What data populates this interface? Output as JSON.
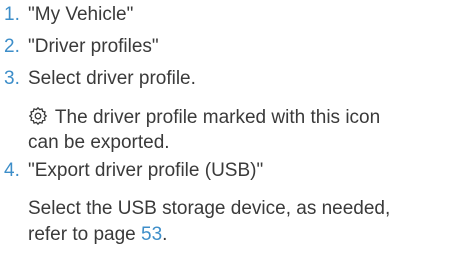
{
  "steps": [
    {
      "number": "1.",
      "text": "\"My Vehicle\""
    },
    {
      "number": "2.",
      "text": "\"Driver profiles\""
    },
    {
      "number": "3.",
      "text": "Select driver profile.",
      "note": {
        "icon": "gear-icon",
        "line1": " The driver profile marked with this icon",
        "line2": "can be exported."
      }
    },
    {
      "number": "4.",
      "text": "\"Export driver profile (USB)\"",
      "note": {
        "line1": "Select the USB storage device, as needed,",
        "line2_prefix": "refer to page ",
        "page_link": "53",
        "line2_suffix": "."
      }
    }
  ],
  "colors": {
    "accent": "#3d8ec9",
    "text": "#3a3a3a"
  }
}
